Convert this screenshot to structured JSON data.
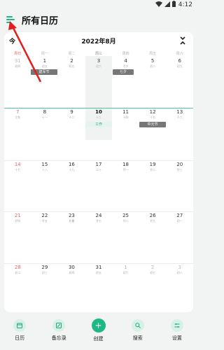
{
  "status": {
    "time": "4:12"
  },
  "header": {
    "title": "所有日历"
  },
  "calendar": {
    "today_label": "今",
    "month": "2022年8月",
    "weekdays": [
      "周日",
      "周一",
      "周二",
      "周三",
      "周四",
      "周五",
      "周六"
    ],
    "weeks": [
      [
        {
          "d": "31",
          "l": "初四",
          "state": "other"
        },
        {
          "d": "1",
          "l": "初五"
        },
        {
          "d": "2",
          "l": "初五"
        },
        {
          "d": "3",
          "l": "初六"
        },
        {
          "d": "4",
          "l": "七夕"
        },
        {
          "d": "5",
          "l": "初八"
        },
        {
          "d": "6",
          "l": "初九"
        }
      ],
      [
        {
          "d": "7",
          "l": "立秋",
          "state": "sun"
        },
        {
          "d": "8",
          "l": "十一"
        },
        {
          "d": "9",
          "l": "十二"
        },
        {
          "d": "10",
          "l": "十三",
          "state": "today"
        },
        {
          "d": "11",
          "l": "十四"
        },
        {
          "d": "12",
          "l": "十五"
        },
        {
          "d": "13",
          "l": "十六"
        }
      ],
      [
        {
          "d": "14",
          "l": "十七",
          "state": "sun"
        },
        {
          "d": "15",
          "l": "十八"
        },
        {
          "d": "16",
          "l": "十九"
        },
        {
          "d": "17",
          "l": "二十"
        },
        {
          "d": "18",
          "l": "廿一"
        },
        {
          "d": "19",
          "l": "廿二"
        },
        {
          "d": "20",
          "l": "廿三"
        }
      ],
      [
        {
          "d": "21",
          "l": "廿四",
          "state": "sun"
        },
        {
          "d": "22",
          "l": "廿五"
        },
        {
          "d": "23",
          "l": "处暑"
        },
        {
          "d": "24",
          "l": "廿七"
        },
        {
          "d": "25",
          "l": "廿八"
        },
        {
          "d": "26",
          "l": "廿九"
        },
        {
          "d": "27",
          "l": "初一"
        }
      ],
      [
        {
          "d": "28",
          "l": "初二",
          "state": "sun"
        },
        {
          "d": "29",
          "l": "初三"
        },
        {
          "d": "30",
          "l": "初四"
        },
        {
          "d": "31",
          "l": "初五"
        },
        {
          "d": "1",
          "l": "初六",
          "state": "other"
        },
        {
          "d": "2",
          "l": "初七",
          "state": "other"
        },
        {
          "d": "3",
          "l": "初八",
          "state": "other"
        }
      ]
    ],
    "events": {
      "jianjun": "建军节",
      "qixi": "七夕",
      "work": "工作",
      "zhongyuan": "中元节"
    }
  },
  "bottom_nav": [
    {
      "label": "日历",
      "icon": "calendar-icon"
    },
    {
      "label": "备忘录",
      "icon": "memo-icon"
    },
    {
      "label": "创建",
      "icon": "plus-icon"
    },
    {
      "label": "搜索",
      "icon": "search-icon"
    },
    {
      "label": "设置",
      "icon": "settings-icon"
    }
  ]
}
